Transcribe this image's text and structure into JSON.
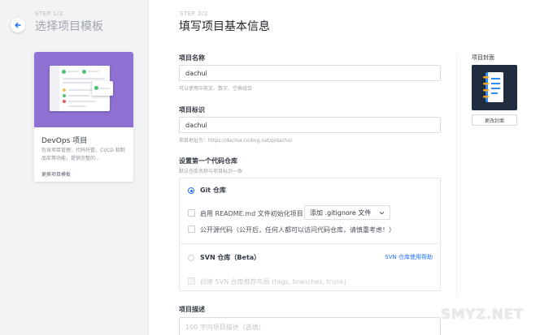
{
  "sidebar": {
    "step_label": "STEP 1/2",
    "title": "选择项目模板",
    "template_card": {
      "name": "DevOps 项目",
      "description": "包含项目管理、代码托管、CI/CD 和制品库等功能，提供完整的...",
      "change_link": "更换项目模板"
    }
  },
  "form": {
    "step_label": "STEP 2/2",
    "title": "填写项目基本信息",
    "project_name": {
      "label": "项目名称",
      "value": "dachui",
      "hint": "可以使用中英文、数字、空格组合"
    },
    "project_id": {
      "label": "项目标识",
      "value": "dachui",
      "hint": "项目地址为：https://dachui.coding.net/p/dachui"
    },
    "repo": {
      "label": "设置第一个代码仓库",
      "hint": "默认仓库名称与项目标识一致",
      "git_option": "Git 仓库",
      "readme_option": "启用 README.md 文件初始化项目",
      "gitignore_select": "添加 .gitignore 文件",
      "public_option": "公开源代码（公开后，任何人都可以访问代码仓库，请慎重考虑！）",
      "svn_option": "SVN 仓库（Beta）",
      "svn_help": "SVN 仓库使用帮助",
      "svn_structure_option": "创建 SVN 仓库推荐布局 (tags, branches, trunk)"
    },
    "description": {
      "label": "项目描述",
      "placeholder": "100 字内项目描述（选填）"
    }
  },
  "cover": {
    "label": "项目封面",
    "change_button": "更改封面"
  },
  "watermark": "SMYZ.NET",
  "colors": {
    "accent": "#1d6fff",
    "template_thumb": "#8f71d4",
    "cover_bg": "#1f2b3e"
  }
}
